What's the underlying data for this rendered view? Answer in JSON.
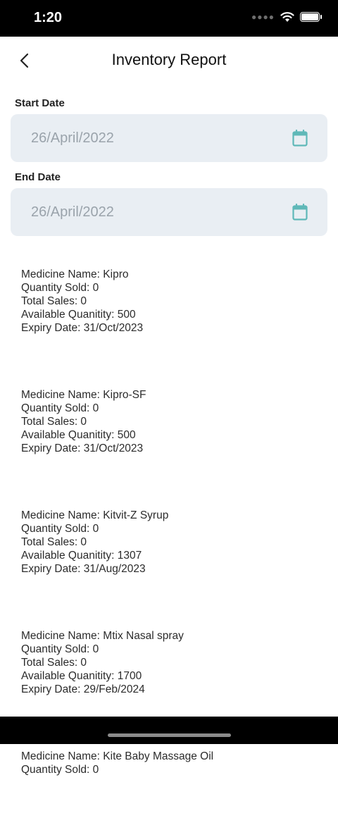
{
  "status": {
    "time": "1:20"
  },
  "header": {
    "title": "Inventory Report"
  },
  "start_date": {
    "label": "Start Date",
    "value": "26/April/2022"
  },
  "end_date": {
    "label": "End Date",
    "value": "26/April/2022"
  },
  "items": [
    {
      "name": "Medicine Name: Kipro",
      "sold": "Quantity Sold: 0",
      "sales": "Total Sales: 0",
      "available": "Available Quanitity: 500",
      "expiry": "Expiry Date: 31/Oct/2023"
    },
    {
      "name": "Medicine Name: Kipro-SF",
      "sold": "Quantity Sold: 0",
      "sales": "Total Sales: 0",
      "available": "Available Quanitity: 500",
      "expiry": "Expiry Date: 31/Oct/2023"
    },
    {
      "name": "Medicine Name: Kitvit-Z Syrup",
      "sold": "Quantity Sold: 0",
      "sales": "Total Sales: 0",
      "available": "Available Quanitity: 1307",
      "expiry": "Expiry Date: 31/Aug/2023"
    },
    {
      "name": "Medicine Name: Mtix Nasal spray",
      "sold": "Quantity Sold: 0",
      "sales": "Total Sales: 0",
      "available": "Available Quanitity: 1700",
      "expiry": "Expiry Date: 29/Feb/2024"
    },
    {
      "name": "Medicine Name: Kite Baby Massage Oil",
      "sold": "Quantity Sold: 0",
      "sales": "",
      "available": "",
      "expiry": ""
    }
  ],
  "colors": {
    "accent": "#5fb8b8",
    "field_bg": "#e9eef3",
    "placeholder": "#9aa3ab"
  }
}
